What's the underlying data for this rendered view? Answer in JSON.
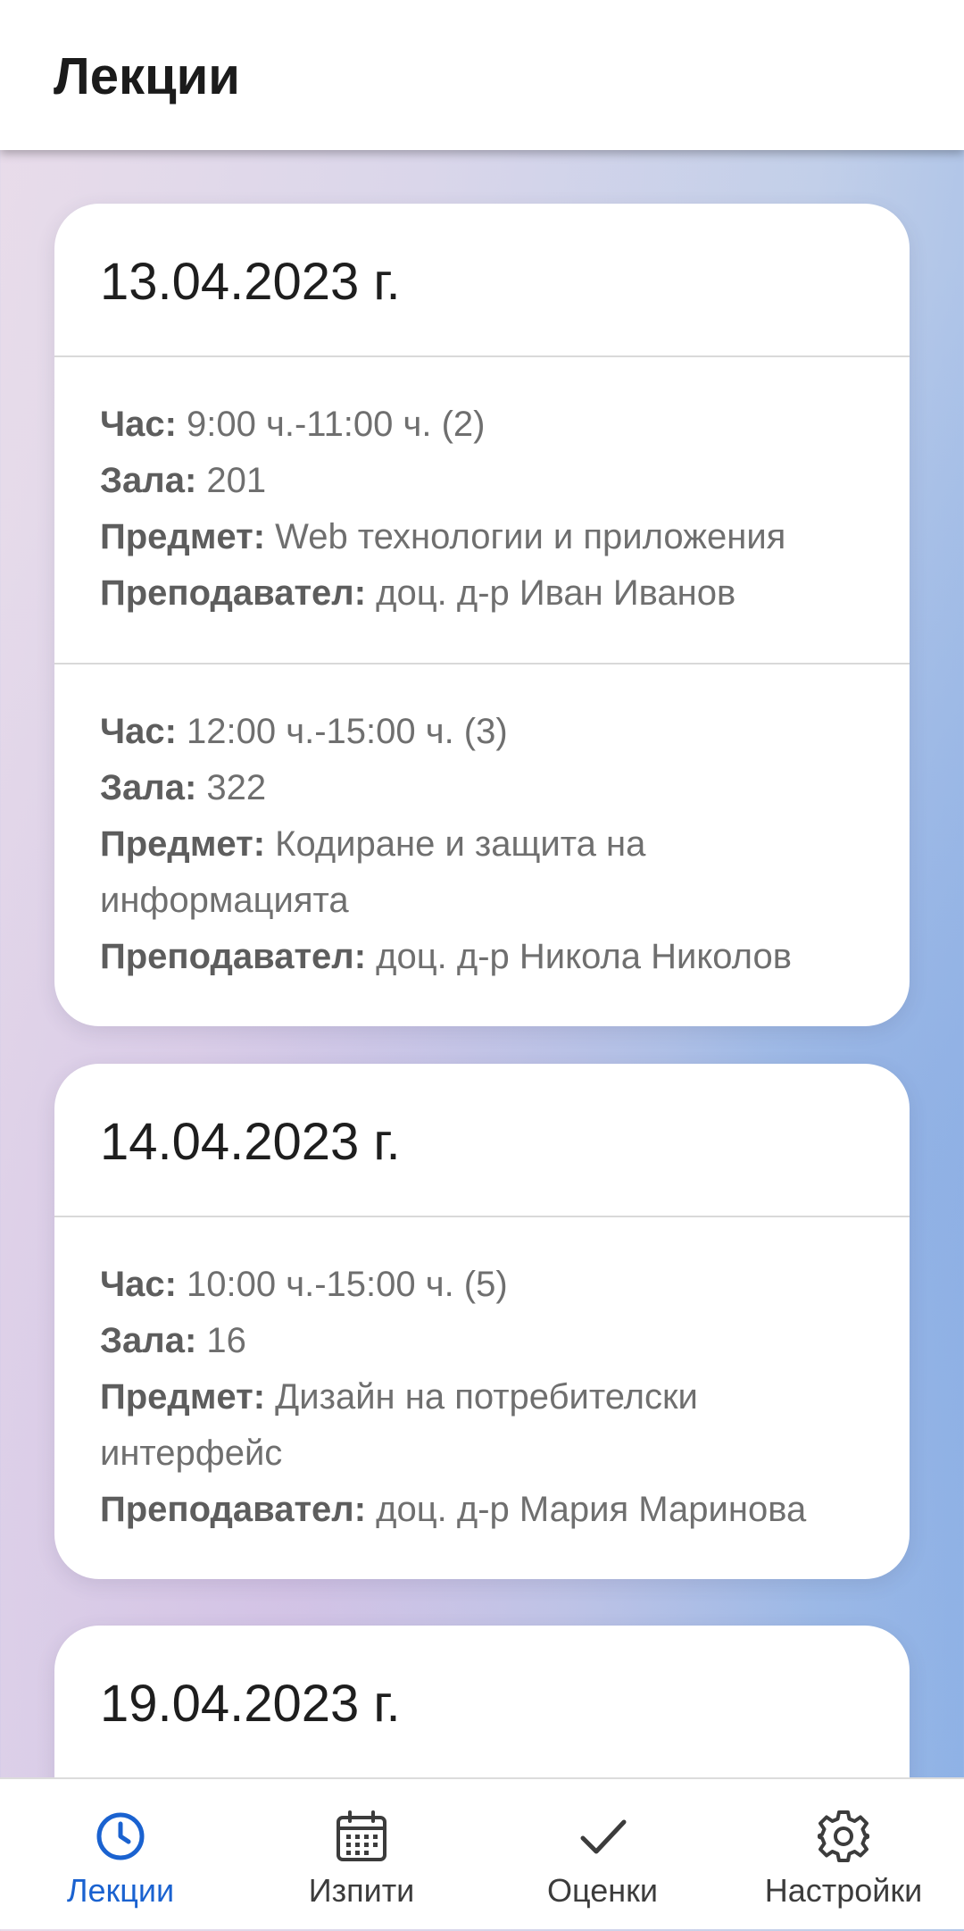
{
  "header": {
    "title": "Лекции"
  },
  "days": [
    {
      "date": "13.04.2023 г.",
      "lectures": [
        {
          "time_label": "Час:",
          "time": "9:00 ч.-11:00 ч. (2)",
          "room_label": "Зала:",
          "room": "201",
          "subject_label": "Предмет:",
          "subject": "Web технологии и приложения",
          "teacher_label": "Преподавател:",
          "teacher": "доц. д-р Иван Иванов"
        },
        {
          "time_label": "Час:",
          "time": "12:00 ч.-15:00 ч. (3)",
          "room_label": "Зала:",
          "room": "322",
          "subject_label": "Предмет:",
          "subject": "Кодиране и защита на информацията",
          "teacher_label": "Преподавател:",
          "teacher": "доц. д-р Никола Николов"
        }
      ]
    },
    {
      "date": "14.04.2023 г.",
      "lectures": [
        {
          "time_label": "Час:",
          "time": "10:00 ч.-15:00 ч. (5)",
          "room_label": "Зала:",
          "room": "16",
          "subject_label": "Предмет:",
          "subject": "Дизайн на потребителски интерфейс",
          "teacher_label": "Преподавател:",
          "teacher": "доц. д-р Мария Маринова"
        }
      ]
    },
    {
      "date": "19.04.2023 г.",
      "lectures": []
    }
  ],
  "bottom_nav": {
    "items": [
      {
        "label": "Лекции",
        "icon": "clock-icon",
        "active": true
      },
      {
        "label": "Изпити",
        "icon": "calendar-icon",
        "active": false
      },
      {
        "label": "Оценки",
        "icon": "checkmark-icon",
        "active": false
      },
      {
        "label": "Настройки",
        "icon": "gear-icon",
        "active": false
      }
    ]
  },
  "colors": {
    "accent": "#1a62d0",
    "card_background": "#ffffff",
    "text_primary": "#1e1e1e",
    "text_secondary": "#6f6f6f"
  }
}
